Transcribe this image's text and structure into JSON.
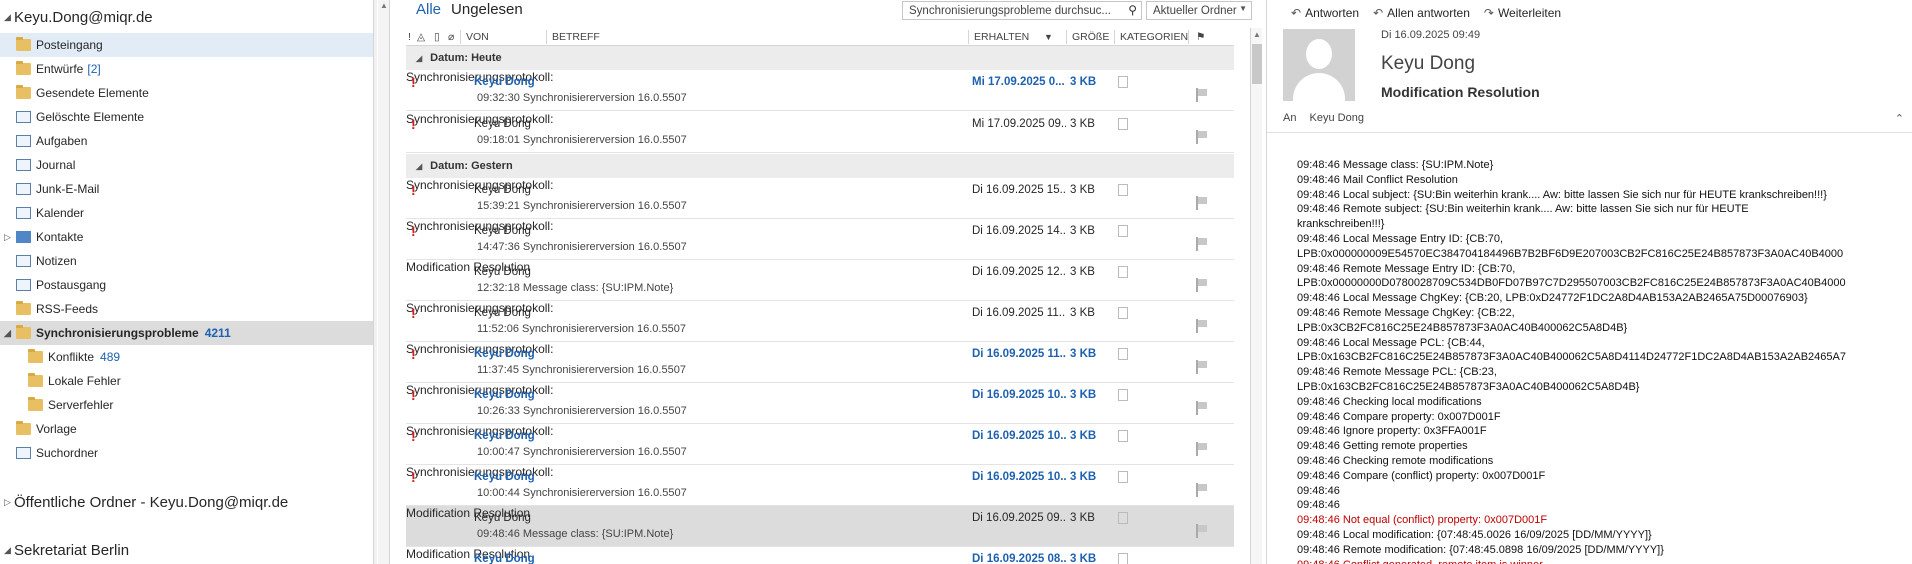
{
  "folder_pane": {
    "account": "Keyu.Dong@miqr.de",
    "folders": [
      {
        "label": "Posteingang",
        "count": "",
        "icon": "inbox-icon",
        "selected": true
      },
      {
        "label": "Entwürfe",
        "count": "[2]",
        "icon": "drafts-icon"
      },
      {
        "label": "Gesendete Elemente",
        "count": "",
        "icon": "sent-icon"
      },
      {
        "label": "Gelöschte Elemente",
        "count": "",
        "icon": "trash-icon"
      },
      {
        "label": "Aufgaben",
        "count": "",
        "icon": "tasks-icon"
      },
      {
        "label": "Journal",
        "count": "",
        "icon": "journal-icon"
      },
      {
        "label": "Junk-E-Mail",
        "count": "",
        "icon": "junk-icon"
      },
      {
        "label": "Kalender",
        "count": "",
        "icon": "calendar-icon"
      },
      {
        "label": "Kontakte",
        "count": "",
        "icon": "contacts-icon"
      },
      {
        "label": "Notizen",
        "count": "",
        "icon": "notes-icon"
      },
      {
        "label": "Postausgang",
        "count": "",
        "icon": "outbox-icon"
      },
      {
        "label": "RSS-Feeds",
        "count": "",
        "icon": "rss-icon"
      },
      {
        "label": "Synchronisierungsprobleme",
        "count": "4211",
        "icon": "folder-icon"
      },
      {
        "label": "Konflikte",
        "count": "489",
        "icon": "folder-icon"
      },
      {
        "label": "Lokale Fehler",
        "count": "",
        "icon": "folder-icon"
      },
      {
        "label": "Serverfehler",
        "count": "",
        "icon": "folder-icon"
      },
      {
        "label": "Vorlage",
        "count": "",
        "icon": "folder-icon"
      },
      {
        "label": "Suchordner",
        "count": "",
        "icon": "search-folder-icon"
      }
    ],
    "public_folders": "Öffentliche Ordner - Keyu.Dong@miqr.de",
    "shared_mailbox": "Sekretariat Berlin"
  },
  "list_pane": {
    "tabs": [
      "Alle",
      "Ungelesen"
    ],
    "search_placeholder": "Synchronisierungsprobleme durchsuc...",
    "scope": "Aktueller Ordner",
    "columns": {
      "from": "VON",
      "subject": "BETREFF",
      "received": "ERHALTEN",
      "size": "GRÖßE",
      "categories": "KATEGORIEN"
    },
    "groups": [
      {
        "label": "Datum: Heute"
      },
      {
        "label": "Datum: Gestern"
      }
    ],
    "messages": [
      {
        "from": "Keyu Dong",
        "subject": "Synchronisierungsprotokoll:",
        "preview": "09:32:30 Synchronisiererversion 16.0.5507",
        "received": "Mi 17.09.2025 0...",
        "size": "3 KB",
        "unread": true,
        "important": true
      },
      {
        "from": "Keyu Dong",
        "subject": "Synchronisierungsprotokoll:",
        "preview": "09:18:01 Synchronisiererversion 16.0.5507",
        "received": "Mi 17.09.2025 09...",
        "size": "3 KB",
        "unread": false,
        "important": true
      },
      {
        "from": "Keyu Dong",
        "subject": "Synchronisierungsprotokoll:",
        "preview": "15:39:21 Synchronisiererversion 16.0.5507",
        "received": "Di 16.09.2025 15...",
        "size": "3 KB",
        "unread": false,
        "important": true
      },
      {
        "from": "Keyu Dong",
        "subject": "Synchronisierungsprotokoll:",
        "preview": "14:47:36 Synchronisiererversion 16.0.5507",
        "received": "Di 16.09.2025 14...",
        "size": "3 KB",
        "unread": false,
        "important": true
      },
      {
        "from": "Keyu Dong",
        "subject": "Modification Resolution",
        "preview": "12:32:18 Message class: {SU:IPM.Note}",
        "received": "Di 16.09.2025 12...",
        "size": "3 KB",
        "unread": false,
        "important": false
      },
      {
        "from": "Keyu Dong",
        "subject": "Synchronisierungsprotokoll:",
        "preview": "11:52:06 Synchronisiererversion 16.0.5507",
        "received": "Di 16.09.2025 11...",
        "size": "3 KB",
        "unread": false,
        "important": true
      },
      {
        "from": "Keyu Dong",
        "subject": "Synchronisierungsprotokoll:",
        "preview": "11:37:45 Synchronisiererversion 16.0.5507",
        "received": "Di 16.09.2025 11...",
        "size": "3 KB",
        "unread": true,
        "important": true
      },
      {
        "from": "Keyu Dong",
        "subject": "Synchronisierungsprotokoll:",
        "preview": "10:26:33 Synchronisiererversion 16.0.5507",
        "received": "Di 16.09.2025 10...",
        "size": "3 KB",
        "unread": true,
        "important": true
      },
      {
        "from": "Keyu Dong",
        "subject": "Synchronisierungsprotokoll:",
        "preview": "10:00:47 Synchronisiererversion 16.0.5507",
        "received": "Di 16.09.2025 10...",
        "size": "3 KB",
        "unread": true,
        "important": true
      },
      {
        "from": "Keyu Dong",
        "subject": "Synchronisierungsprotokoll:",
        "preview": "10:00:44 Synchronisiererversion 16.0.5507",
        "received": "Di 16.09.2025 10...",
        "size": "3 KB",
        "unread": true,
        "important": true
      },
      {
        "from": "Keyu Dong",
        "subject": "Modification Resolution",
        "preview": "09:48:46 Message class: {SU:IPM.Note}",
        "received": "Di 16.09.2025 09...",
        "size": "3 KB",
        "unread": false,
        "important": false,
        "selected": true
      },
      {
        "from": "Keyu Dong",
        "subject": "Modification Resolution",
        "preview": "",
        "received": "Di 16.09.2025 08...",
        "size": "3 KB",
        "unread": true,
        "important": false
      }
    ]
  },
  "reading_pane": {
    "actions": [
      "Antworten",
      "Allen antworten",
      "Weiterleiten"
    ],
    "date": "Di 16.09.2025 09:49",
    "sender": "Keyu Dong",
    "subject": "Modification Resolution",
    "to_label": "An",
    "to_value": "Keyu Dong",
    "body_lines": [
      {
        "text": "09:48:46 Message class: {SU:IPM.Note}"
      },
      {
        "text": "09:48:46 Mail Conflict Resolution"
      },
      {
        "text": "09:48:46 Local subject: {SU:Bin weiterhin krank.... Aw: bitte lassen Sie sich nur für HEUTE krankschreiben!!!}"
      },
      {
        "text": "09:48:46 Remote subject: {SU:Bin weiterhin krank.... Aw: bitte lassen Sie sich nur für HEUTE"
      },
      {
        "text": "krankschreiben!!!}"
      },
      {
        "text": "09:48:46 Local Message Entry ID: {CB:70,"
      },
      {
        "text": "LPB:0x000000009E54570EC384704184496B7B2BF6D9E207003CB2FC816C25E24B857873F3A0AC40B4000"
      },
      {
        "text": "09:48:46 Remote Message Entry ID: {CB:70,"
      },
      {
        "text": "LPB:0x00000000D0780028709C534DB0FD07B97C7D295507003CB2FC816C25E24B857873F3A0AC40B4000"
      },
      {
        "text": "09:48:46 Local Message ChgKey: {CB:20, LPB:0xD24772F1DC2A8D4AB153A2AB2465A75D00076903}"
      },
      {
        "text": "09:48:46 Remote Message ChgKey: {CB:22,"
      },
      {
        "text": "LPB:0x3CB2FC816C25E24B857873F3A0AC40B400062C5A8D4B}"
      },
      {
        "text": "09:48:46 Local Message PCL: {CB:44,"
      },
      {
        "text": "LPB:0x163CB2FC816C25E24B857873F3A0AC40B400062C5A8D4114D24772F1DC2A8D4AB153A2AB2465A7"
      },
      {
        "text": "09:48:46 Remote Message PCL: {CB:23,"
      },
      {
        "text": "LPB:0x163CB2FC816C25E24B857873F3A0AC40B400062C5A8D4B}"
      },
      {
        "text": "09:48:46 Checking local modifications"
      },
      {
        "text": "09:48:46 Compare property: 0x007D001F"
      },
      {
        "text": "09:48:46 Ignore property: 0x3FFA001F"
      },
      {
        "text": "09:48:46 Getting remote properties"
      },
      {
        "text": "09:48:46 Checking remote modifications"
      },
      {
        "text": "09:48:46 Compare (conflict) property: 0x007D001F"
      },
      {
        "text": "09:48:46"
      },
      {
        "text": "09:48:46"
      },
      {
        "text": "09:48:46 Not equal (conflict) property: 0x007D001F",
        "red": true
      },
      {
        "text": "09:48:46 Local modification: {07:48:45.0026  16/09/2025 [DD/MM/YYYY]}"
      },
      {
        "text": "09:48:46 Remote modification: {07:48:45.0898  16/09/2025 [DD/MM/YYYY]}"
      },
      {
        "text": "09:48:46 Conflict generated, remote item is winner",
        "red": true
      }
    ]
  }
}
